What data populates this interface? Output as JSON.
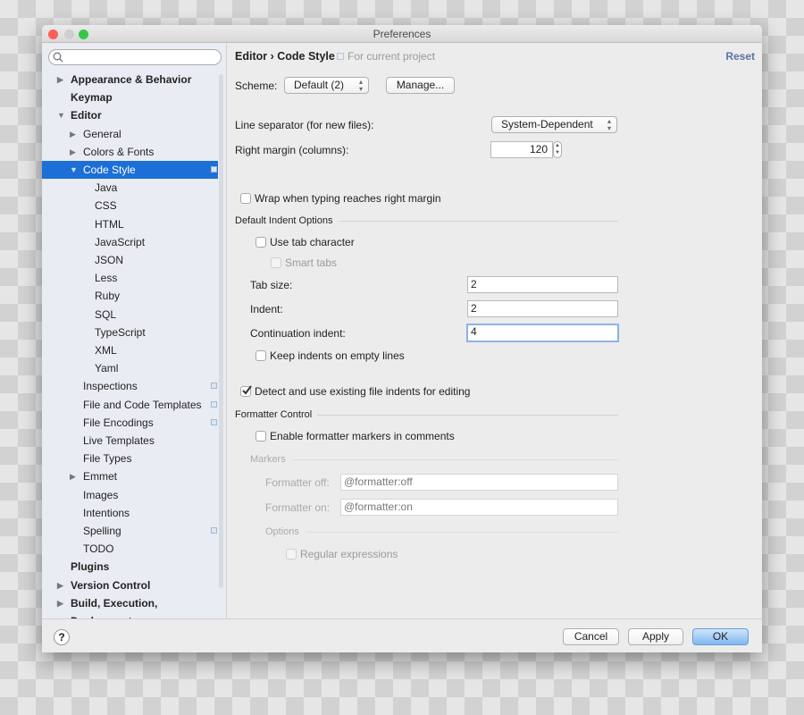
{
  "window": {
    "title": "Preferences"
  },
  "sidebar": {
    "search_placeholder": "",
    "items": [
      {
        "label": "Appearance & Behavior",
        "level": 0,
        "bold": true,
        "arrow": "right"
      },
      {
        "label": "Keymap",
        "level": 0,
        "bold": true,
        "arrow": ""
      },
      {
        "label": "Editor",
        "level": 0,
        "bold": true,
        "arrow": "down"
      },
      {
        "label": "General",
        "level": 1,
        "arrow": "right"
      },
      {
        "label": "Colors & Fonts",
        "level": 1,
        "arrow": "right"
      },
      {
        "label": "Code Style",
        "level": 1,
        "arrow": "down",
        "selected": true,
        "badge": true
      },
      {
        "label": "Java",
        "level": 2
      },
      {
        "label": "CSS",
        "level": 2
      },
      {
        "label": "HTML",
        "level": 2
      },
      {
        "label": "JavaScript",
        "level": 2
      },
      {
        "label": "JSON",
        "level": 2
      },
      {
        "label": "Less",
        "level": 2
      },
      {
        "label": "Ruby",
        "level": 2
      },
      {
        "label": "SQL",
        "level": 2
      },
      {
        "label": "TypeScript",
        "level": 2
      },
      {
        "label": "XML",
        "level": 2
      },
      {
        "label": "Yaml",
        "level": 2
      },
      {
        "label": "Inspections",
        "level": 1,
        "badge": true
      },
      {
        "label": "File and Code Templates",
        "level": 1,
        "badge": true
      },
      {
        "label": "File Encodings",
        "level": 1,
        "badge": true
      },
      {
        "label": "Live Templates",
        "level": 1
      },
      {
        "label": "File Types",
        "level": 1
      },
      {
        "label": "Emmet",
        "level": 1,
        "arrow": "right"
      },
      {
        "label": "Images",
        "level": 1
      },
      {
        "label": "Intentions",
        "level": 1
      },
      {
        "label": "Spelling",
        "level": 1,
        "badge": true
      },
      {
        "label": "TODO",
        "level": 1
      },
      {
        "label": "Plugins",
        "level": 0,
        "bold": true
      },
      {
        "label": "Version Control",
        "level": 0,
        "bold": true,
        "arrow": "right"
      },
      {
        "label": "Build, Execution, Deployment",
        "level": 0,
        "bold": true,
        "arrow": "right"
      }
    ]
  },
  "header": {
    "breadcrumb": "Editor › Code Style",
    "scope": "For current project",
    "reset": "Reset"
  },
  "scheme": {
    "label": "Scheme:",
    "value": "Default (2)",
    "manage": "Manage..."
  },
  "line_separator": {
    "label": "Line separator (for new files):",
    "value": "System-Dependent"
  },
  "right_margin": {
    "label": "Right margin (columns):",
    "value": "120"
  },
  "wrap": {
    "label": "Wrap when typing reaches right margin",
    "checked": false
  },
  "indent": {
    "title": "Default Indent Options",
    "use_tab": "Use tab character",
    "smart_tabs": "Smart tabs",
    "tab_size_label": "Tab size:",
    "tab_size": "2",
    "indent_label": "Indent:",
    "indent": "2",
    "cont_label": "Continuation indent:",
    "cont": "4",
    "keep": "Keep indents on empty lines"
  },
  "detect": {
    "label": "Detect and use existing file indents for editing",
    "checked": true
  },
  "formatter": {
    "title": "Formatter Control",
    "enable": "Enable formatter markers in comments",
    "markers": "Markers",
    "off_label": "Formatter off:",
    "off": "@formatter:off",
    "on_label": "Formatter on:",
    "on": "@formatter:on",
    "options": "Options",
    "regex": "Regular expressions"
  },
  "footer": {
    "help": "?",
    "cancel": "Cancel",
    "apply": "Apply",
    "ok": "OK"
  },
  "colors": {
    "selection": "#1c6fd6",
    "reset_link": "#5a72a8",
    "ok_button": "#7fb8f0"
  }
}
